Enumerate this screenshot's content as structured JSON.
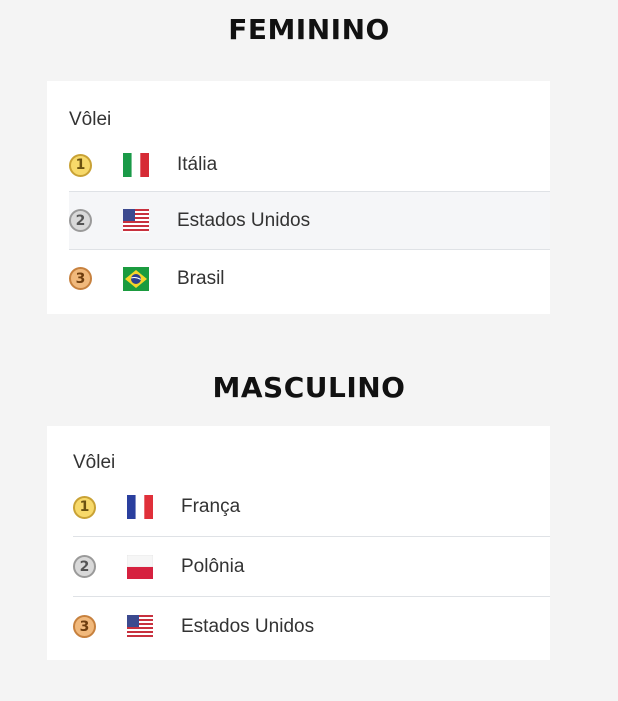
{
  "sections": [
    {
      "title": "FEMININO",
      "sport": "Vôlei",
      "rows": [
        {
          "rank": "1",
          "medal": "gold",
          "flag": "italy-flag-icon",
          "country": "Itália"
        },
        {
          "rank": "2",
          "medal": "silver",
          "flag": "usa-flag-icon",
          "country": "Estados Unidos"
        },
        {
          "rank": "3",
          "medal": "bronze",
          "flag": "brazil-flag-icon",
          "country": "Brasil"
        }
      ]
    },
    {
      "title": "MASCULINO",
      "sport": "Vôlei",
      "rows": [
        {
          "rank": "1",
          "medal": "gold",
          "flag": "france-flag-icon",
          "country": "França"
        },
        {
          "rank": "2",
          "medal": "silver",
          "flag": "poland-flag-icon",
          "country": "Polônia"
        },
        {
          "rank": "3",
          "medal": "bronze",
          "flag": "usa-flag-icon",
          "country": "Estados Unidos"
        }
      ]
    }
  ],
  "colors": {
    "background": "#f4f4f4",
    "card": "#ffffff",
    "gold": "#f7d96a",
    "silver": "#d9d9d9",
    "bronze": "#f1b97c"
  }
}
